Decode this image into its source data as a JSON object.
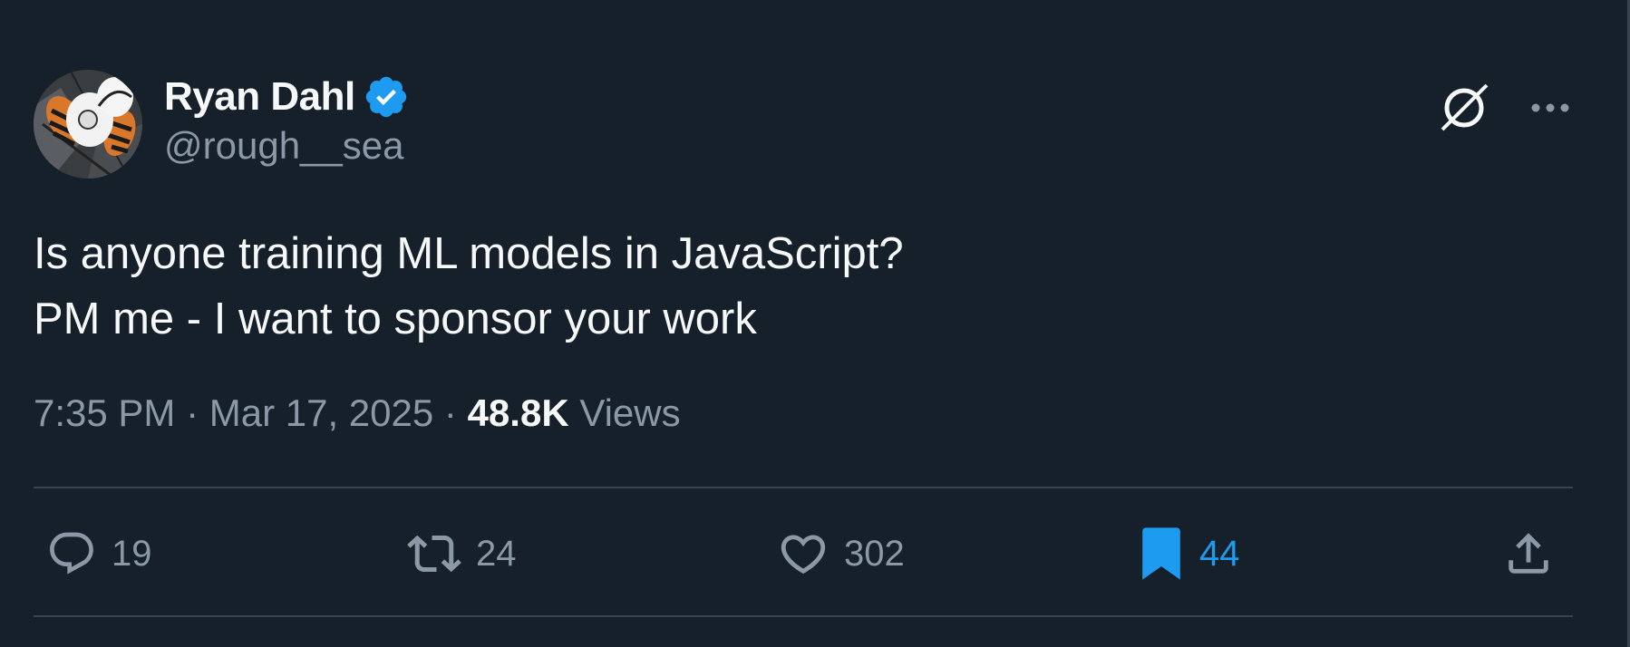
{
  "colors": {
    "background": "#15202b",
    "text_primary": "#f7f9f9",
    "text_secondary": "#8b98a5",
    "accent": "#1d9bf0",
    "divider": "#38444d"
  },
  "author": {
    "display_name": "Ryan Dahl",
    "handle": "@rough__sea",
    "verified": true,
    "verified_icon": "verified-badge-icon",
    "avatar": "avatar-image"
  },
  "header_actions": {
    "grok_icon": "grok-slash-circle-icon",
    "more_icon": "more-dots-icon"
  },
  "tweet": {
    "lines": [
      "Is anyone training ML models in JavaScript?",
      "PM me - I want to sponsor your work"
    ]
  },
  "meta": {
    "time": "7:35 PM",
    "separator": " · ",
    "date": "Mar 17, 2025",
    "views_count": "48.8K",
    "views_label": " Views"
  },
  "actions": {
    "reply": {
      "icon": "reply-bubble-icon",
      "count": "19"
    },
    "retweet": {
      "icon": "retweet-icon",
      "count": "24"
    },
    "like": {
      "icon": "heart-icon",
      "count": "302"
    },
    "bookmark": {
      "icon": "bookmark-filled-icon",
      "count": "44",
      "active": true
    },
    "share": {
      "icon": "share-upload-icon"
    }
  }
}
